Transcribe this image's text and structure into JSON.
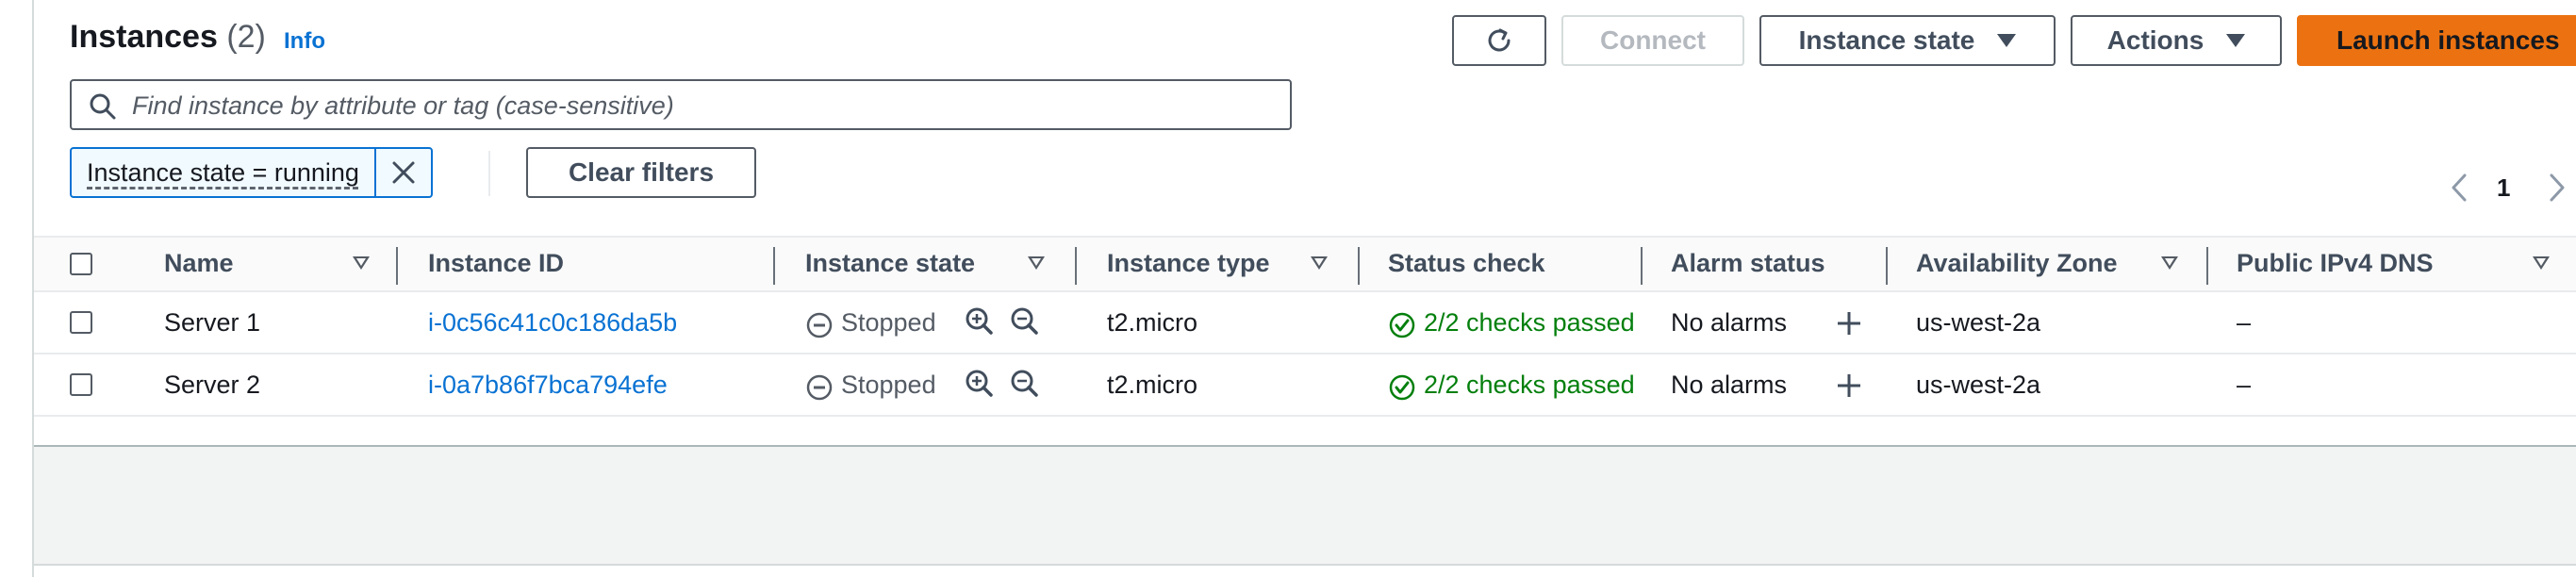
{
  "header": {
    "title": "Instances",
    "count": "(2)",
    "info": "Info"
  },
  "actions": {
    "connect": "Connect",
    "instance_state": "Instance state",
    "actions": "Actions",
    "launch": "Launch instances"
  },
  "search": {
    "placeholder": "Find instance by attribute or tag (case-sensitive)"
  },
  "filter": {
    "token": "Instance state = running",
    "clear": "Clear filters"
  },
  "pagination": {
    "current_page": "1"
  },
  "table": {
    "columns": [
      "Name",
      "Instance ID",
      "Instance state",
      "Instance type",
      "Status check",
      "Alarm status",
      "Availability Zone",
      "Public IPv4 DNS"
    ],
    "rows": [
      {
        "name": "Server 1",
        "instance_id": "i-0c56c41c0c186da5b",
        "state": "Stopped",
        "type": "t2.micro",
        "status_check": "2/2 checks passed",
        "alarm": "No alarms",
        "az": "us-west-2a",
        "dns": "–"
      },
      {
        "name": "Server 2",
        "instance_id": "i-0a7b86f7bca794efe",
        "state": "Stopped",
        "type": "t2.micro",
        "status_check": "2/2 checks passed",
        "alarm": "No alarms",
        "az": "us-west-2a",
        "dns": "–"
      }
    ]
  },
  "colors": {
    "primary": "#ec7211",
    "link": "#0972d3",
    "success": "#037f0c",
    "muted": "#545b64"
  },
  "icons": {
    "refresh": "refresh-icon",
    "search": "search-icon",
    "close": "close-icon",
    "stopped": "stopped-icon",
    "zoom_in": "zoom-in-icon",
    "zoom_out": "zoom-out-icon",
    "check": "check-circle-icon",
    "add": "plus-icon",
    "prev": "chevron-left-icon",
    "next": "chevron-right-icon"
  }
}
